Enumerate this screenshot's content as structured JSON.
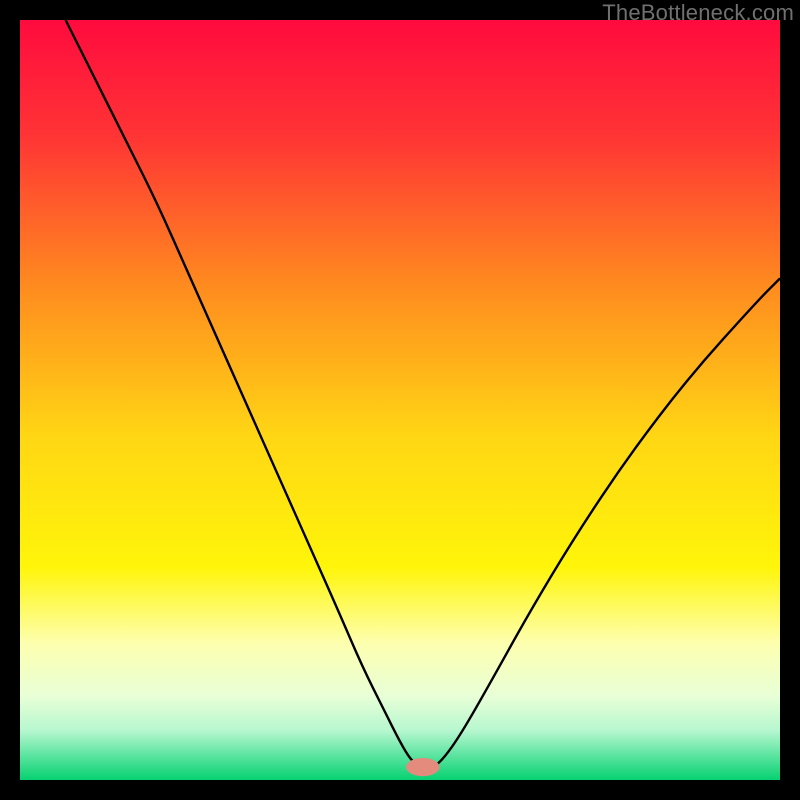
{
  "watermark": "TheBottleneck.com",
  "chart_data": {
    "type": "line",
    "title": "",
    "xlabel": "",
    "ylabel": "",
    "xlim": [
      0,
      100
    ],
    "ylim": [
      0,
      100
    ],
    "background": {
      "type": "vertical-gradient",
      "stops": [
        {
          "offset": 0.0,
          "color": "#ff0b3e"
        },
        {
          "offset": 0.15,
          "color": "#ff3335"
        },
        {
          "offset": 0.35,
          "color": "#ff8b1f"
        },
        {
          "offset": 0.55,
          "color": "#ffd714"
        },
        {
          "offset": 0.72,
          "color": "#fff50a"
        },
        {
          "offset": 0.82,
          "color": "#fdffaf"
        },
        {
          "offset": 0.89,
          "color": "#e8ffd7"
        },
        {
          "offset": 0.935,
          "color": "#b6f7cf"
        },
        {
          "offset": 0.965,
          "color": "#63e6a4"
        },
        {
          "offset": 1.0,
          "color": "#06d171"
        }
      ]
    },
    "series": [
      {
        "name": "bottleneck-curve",
        "stroke": "#000000",
        "strokeWidth": 2.4,
        "x": [
          6,
          10,
          14,
          18,
          22,
          26,
          30,
          34,
          38,
          42,
          45,
          48,
          50,
          51.5,
          53,
          54,
          55.5,
          58,
          62,
          67,
          73,
          80,
          88,
          97,
          100
        ],
        "y": [
          100,
          92,
          84,
          76,
          67,
          58,
          49,
          40,
          31,
          22,
          15,
          9,
          5,
          2.5,
          1.5,
          1.5,
          2.5,
          6,
          13,
          22,
          32,
          42.5,
          53,
          63,
          66
        ]
      }
    ],
    "marker": {
      "name": "optimal-point",
      "x": 53,
      "y": 1.7,
      "rx": 2.2,
      "ry": 1.2,
      "color": "#e48b7e"
    }
  }
}
